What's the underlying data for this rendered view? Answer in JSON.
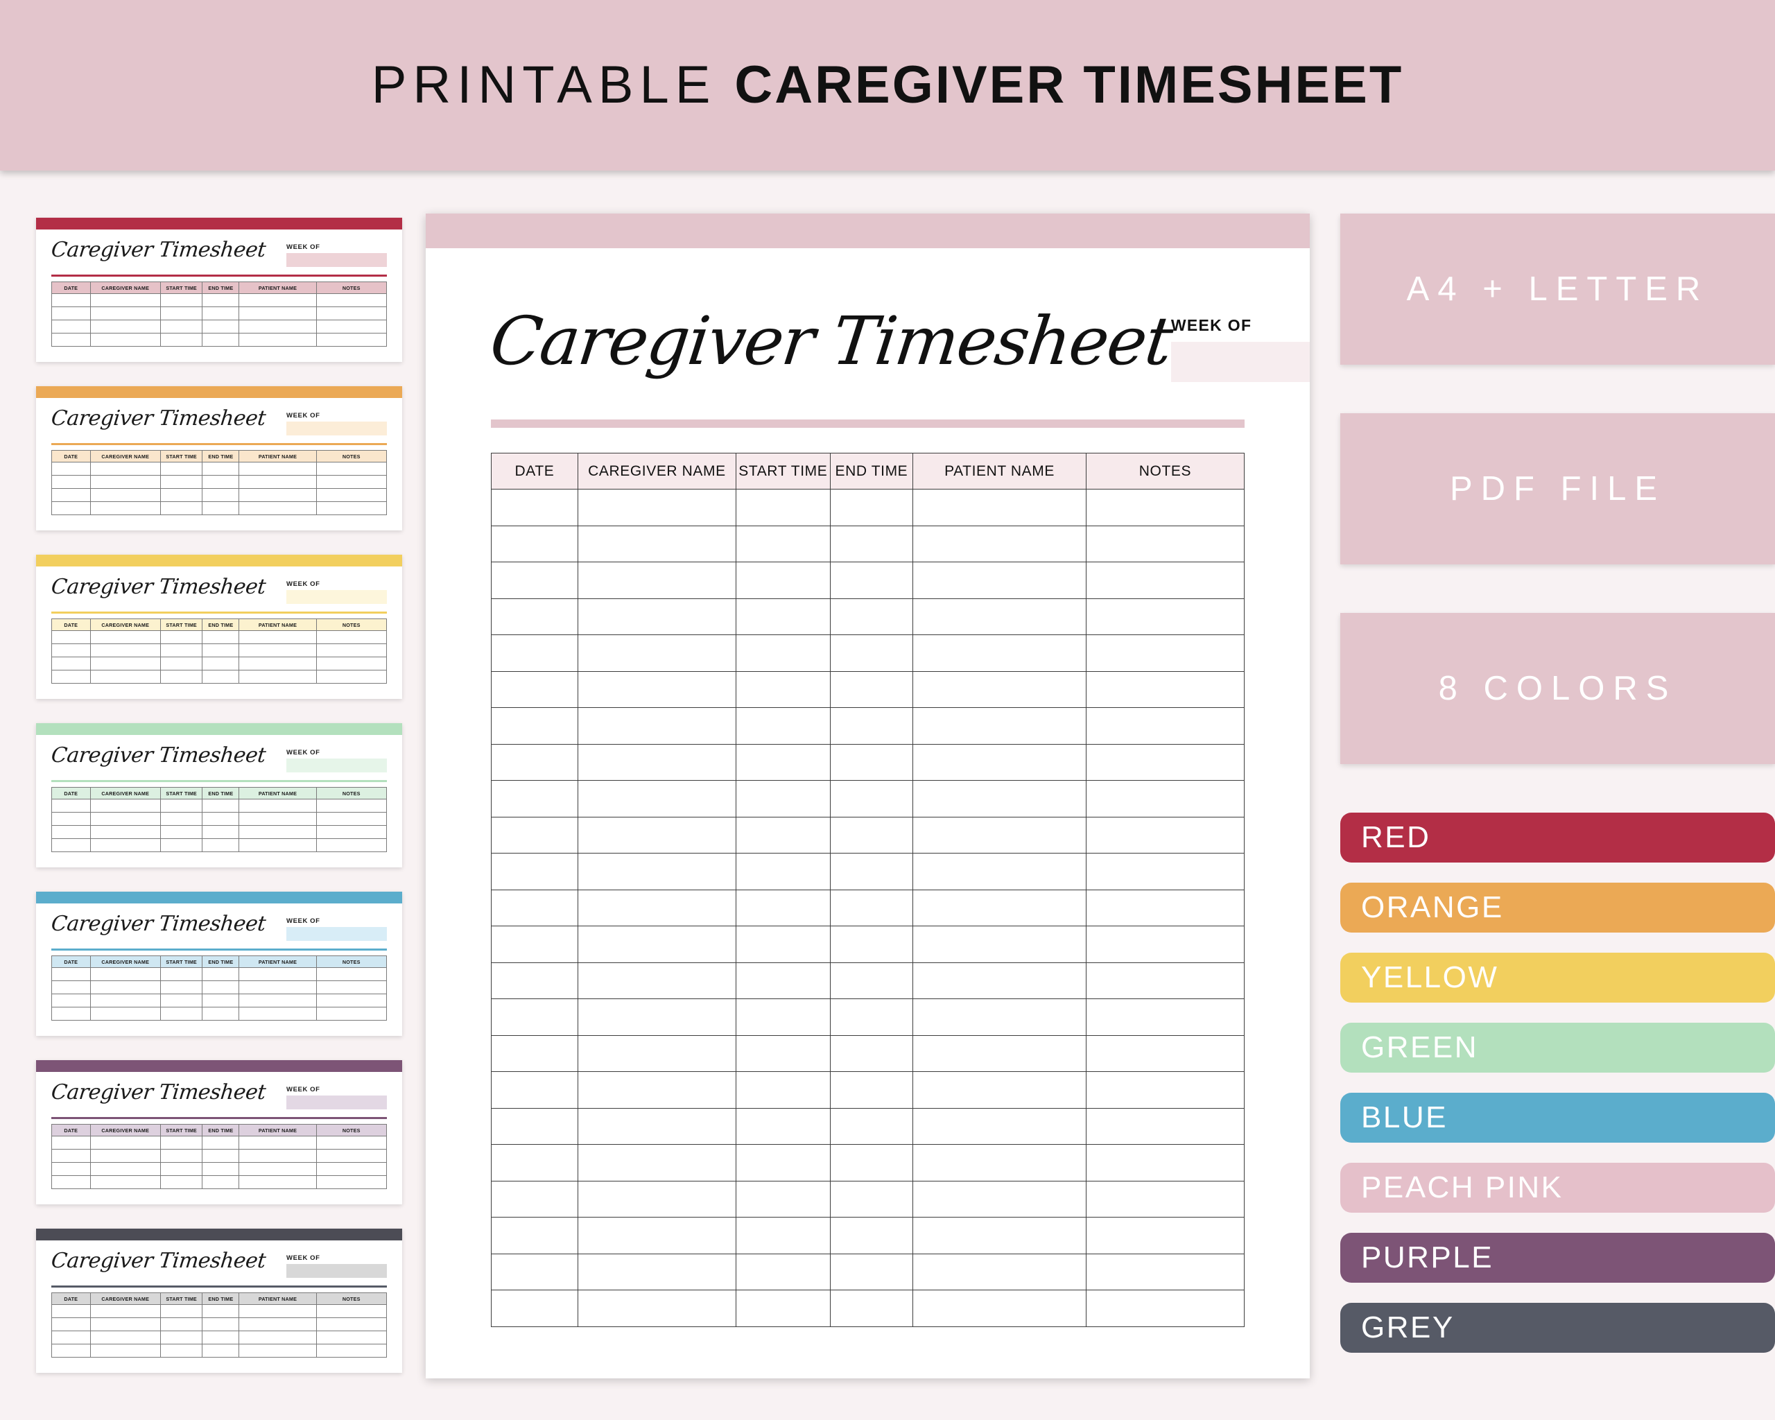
{
  "header": {
    "title_thin": "PRINTABLE",
    "title_bold": "CAREGIVER TIMESHEET"
  },
  "theme": {
    "banner_pink": "#E3C5CC",
    "page_background": "#F8F2F3",
    "preview_header_fill": "#F7EAEC",
    "weekof_fill": "#F7EDEF"
  },
  "table": {
    "columns": [
      "DATE",
      "CAREGIVER NAME",
      "START TIME",
      "END TIME",
      "PATIENT NAME",
      "NOTES"
    ],
    "row_count": 23
  },
  "preview": {
    "title": "Caregiver Timesheet",
    "weekof_label": "WEEK OF",
    "weekof_value": ""
  },
  "thumbnails": [
    {
      "title": "Caregiver Timesheet",
      "weekof_label": "WEEK OF",
      "color_name": "RED",
      "bar": "#B32E46",
      "accent": "#B32E46",
      "header_fill": "#E6C2C8",
      "field_fill": "#EED3D7"
    },
    {
      "title": "Caregiver Timesheet",
      "weekof_label": "WEEK OF",
      "color_name": "ORANGE",
      "bar": "#EBA955",
      "accent": "#EBA955",
      "header_fill": "#FAE6CC",
      "field_fill": "#FCEDD8"
    },
    {
      "title": "Caregiver Timesheet",
      "weekof_label": "WEEK OF",
      "color_name": "YELLOW",
      "bar": "#F2CF5E",
      "accent": "#F2CF5E",
      "header_fill": "#FCF2CF",
      "field_fill": "#FDF6DC"
    },
    {
      "title": "Caregiver Timesheet",
      "weekof_label": "WEEK OF",
      "color_name": "GREEN",
      "bar": "#B3E0BD",
      "accent": "#B3E0BD",
      "header_fill": "#DCF0E1",
      "field_fill": "#E6F5E9"
    },
    {
      "title": "Caregiver Timesheet",
      "weekof_label": "WEEK OF",
      "color_name": "BLUE",
      "bar": "#5BADCC",
      "accent": "#5BADCC",
      "header_fill": "#CFE7F2",
      "field_fill": "#D8EDF7"
    },
    {
      "title": "Caregiver Timesheet",
      "weekof_label": "WEEK OF",
      "color_name": "PURPLE",
      "bar": "#7D5476",
      "accent": "#7D5476",
      "header_fill": "#DDD0DE",
      "field_fill": "#E3D8E4"
    },
    {
      "title": "Caregiver Timesheet",
      "weekof_label": "WEEK OF",
      "color_name": "GREY",
      "bar": "#4C4C55",
      "accent": "#565A66",
      "header_fill": "#D8D8D8",
      "field_fill": "#D8D8D8"
    }
  ],
  "features": [
    {
      "label": "A4 + LETTER"
    },
    {
      "label": "PDF FILE"
    },
    {
      "label": "8 COLORS"
    }
  ],
  "colors": [
    {
      "label": "RED",
      "hex": "#B32E46"
    },
    {
      "label": "ORANGE",
      "hex": "#EBA955"
    },
    {
      "label": "YELLOW",
      "hex": "#F2CF5E"
    },
    {
      "label": "GREEN",
      "hex": "#B3E0BD"
    },
    {
      "label": "BLUE",
      "hex": "#5BADCC"
    },
    {
      "label": "PEACH PINK",
      "hex": "#E5C0CA"
    },
    {
      "label": "PURPLE",
      "hex": "#7D5476"
    },
    {
      "label": "GREY",
      "hex": "#565A66"
    }
  ]
}
